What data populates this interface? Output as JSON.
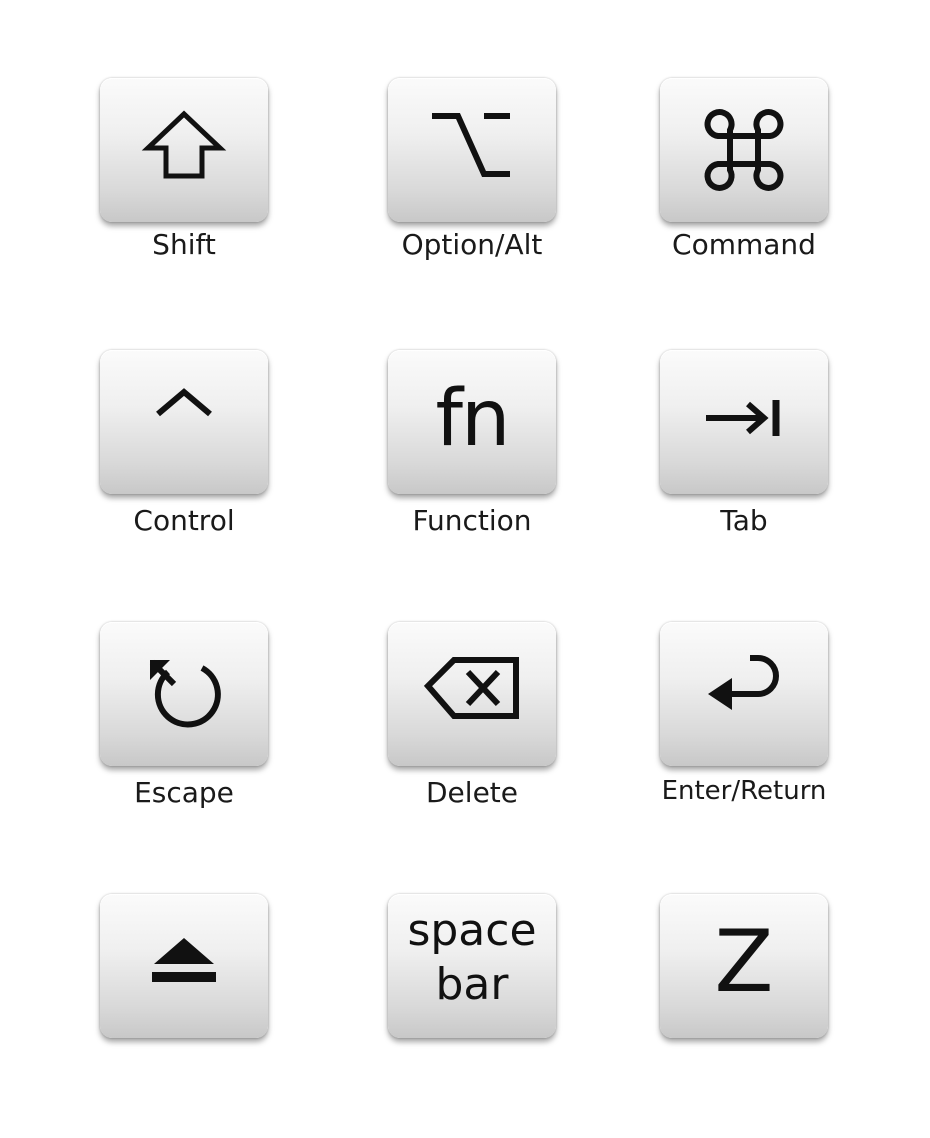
{
  "keys": [
    {
      "id": "shift",
      "label": "Shift",
      "icon": "shift-arrow-icon"
    },
    {
      "id": "option",
      "label": "Option/Alt",
      "icon": "option-icon"
    },
    {
      "id": "command",
      "label": "Command",
      "icon": "command-icon"
    },
    {
      "id": "control",
      "label": "Control",
      "icon": "caret-up-icon"
    },
    {
      "id": "function",
      "label": "Function",
      "glyph": "fn"
    },
    {
      "id": "tab",
      "label": "Tab",
      "icon": "tab-arrow-icon"
    },
    {
      "id": "escape",
      "label": "Escape",
      "icon": "escape-icon"
    },
    {
      "id": "delete",
      "label": "Delete",
      "icon": "delete-icon"
    },
    {
      "id": "enter",
      "label": "Enter/Return",
      "icon": "return-icon"
    },
    {
      "id": "eject",
      "icon": "eject-icon"
    },
    {
      "id": "space",
      "glyph_line1": "space",
      "glyph_line2": "bar"
    },
    {
      "id": "z",
      "glyph": "Z"
    }
  ]
}
